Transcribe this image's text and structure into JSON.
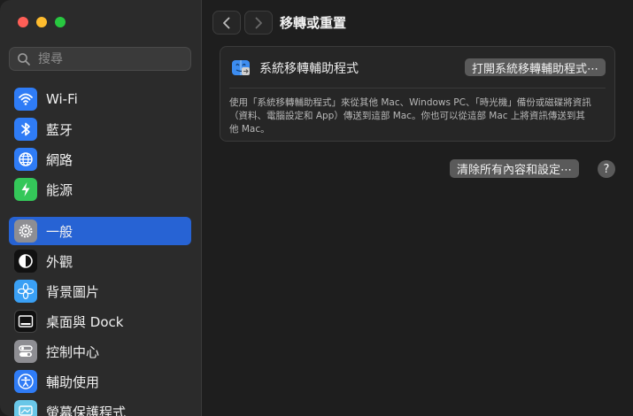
{
  "window": {
    "title": "移轉或重置"
  },
  "search": {
    "placeholder": "搜尋"
  },
  "sidebar": {
    "items": [
      {
        "label": "Wi-Fi",
        "icon": "wifi-icon",
        "color": "#2f7cf6"
      },
      {
        "label": "藍牙",
        "icon": "bluetooth-icon",
        "color": "#2f7cf6"
      },
      {
        "label": "網路",
        "icon": "globe-icon",
        "color": "#2f7cf6"
      },
      {
        "label": "能源",
        "icon": "battery-bolt-icon",
        "color": "#34c759"
      },
      {
        "label": "一般",
        "icon": "gear-icon",
        "color": "#8e8e93",
        "selected": true
      },
      {
        "label": "外觀",
        "icon": "appearance-icon",
        "color": "#111111"
      },
      {
        "label": "背景圖片",
        "icon": "flower-icon",
        "color": "#3aa0f5"
      },
      {
        "label": "桌面與 Dock",
        "icon": "dock-icon",
        "color": "#111111"
      },
      {
        "label": "控制中心",
        "icon": "control-center-icon",
        "color": "#8e8e93"
      },
      {
        "label": "輔助使用",
        "icon": "accessibility-icon",
        "color": "#2f7cf6"
      },
      {
        "label": "螢幕保護程式",
        "icon": "screensaver-icon",
        "color": "#69c7e8"
      }
    ]
  },
  "migration": {
    "title": "系統移轉輔助程式",
    "button": "打開系統移轉輔助程式⋯",
    "description": "使用「系統移轉輔助程式」來從其他 Mac、Windows PC、「時光機」備份或磁碟將資訊（資料、電腦設定和 App）傳送到這部 Mac。你也可以從這部 Mac 上將資訊傳送到其他 Mac。"
  },
  "erase": {
    "button": "清除所有內容和設定⋯"
  },
  "help": {
    "label": "?"
  },
  "colors": {
    "accent": "#2763d4"
  }
}
